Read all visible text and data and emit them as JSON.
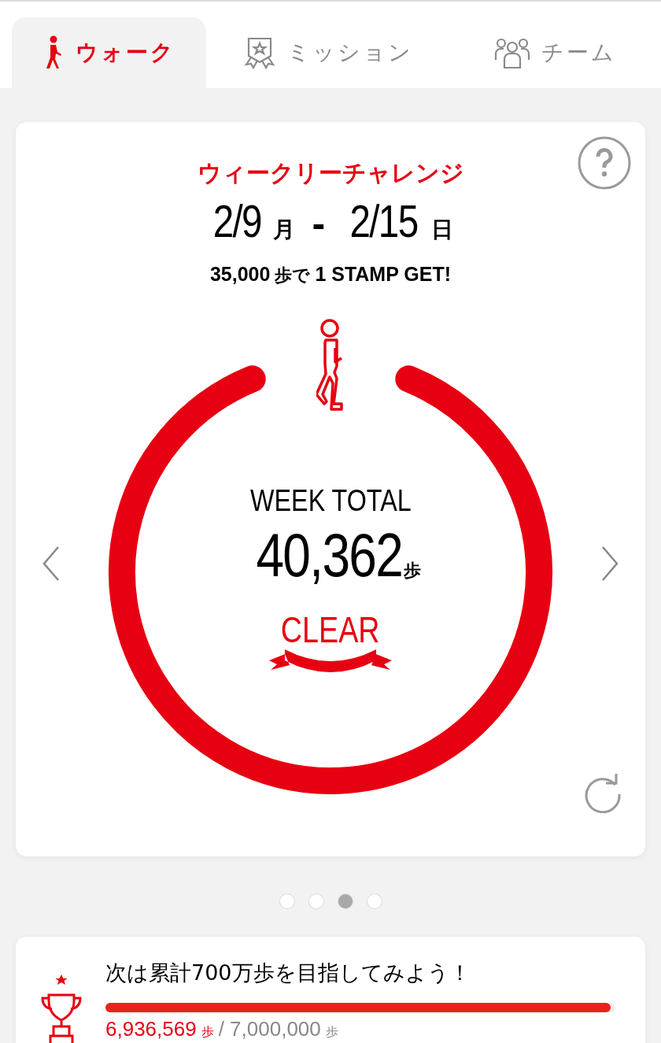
{
  "tabs": [
    {
      "label": "ウォーク",
      "selected": true
    },
    {
      "label": "ミッション",
      "selected": false
    },
    {
      "label": "チーム",
      "selected": false
    }
  ],
  "weekly": {
    "title": "ウィークリーチャレンジ",
    "start_date": "2/9",
    "start_day": "月",
    "separator": "-",
    "end_date": "2/15",
    "end_day": "日",
    "goal_steps": "35,000",
    "goal_unit": "歩で",
    "goal_reward": "1 STAMP GET!",
    "total_label": "WEEK TOTAL",
    "total_steps": "40,362",
    "total_unit": "歩",
    "status": "CLEAR"
  },
  "pager": [
    {
      "selected": false
    },
    {
      "selected": false
    },
    {
      "selected": true
    },
    {
      "selected": false
    }
  ],
  "cumulative": {
    "message": "次は累計700万歩を目指してみよう！",
    "level": 0.99,
    "current": "6,936,569",
    "current_unit": "歩",
    "target": "/ 7,000,000",
    "target_unit": "歩"
  }
}
